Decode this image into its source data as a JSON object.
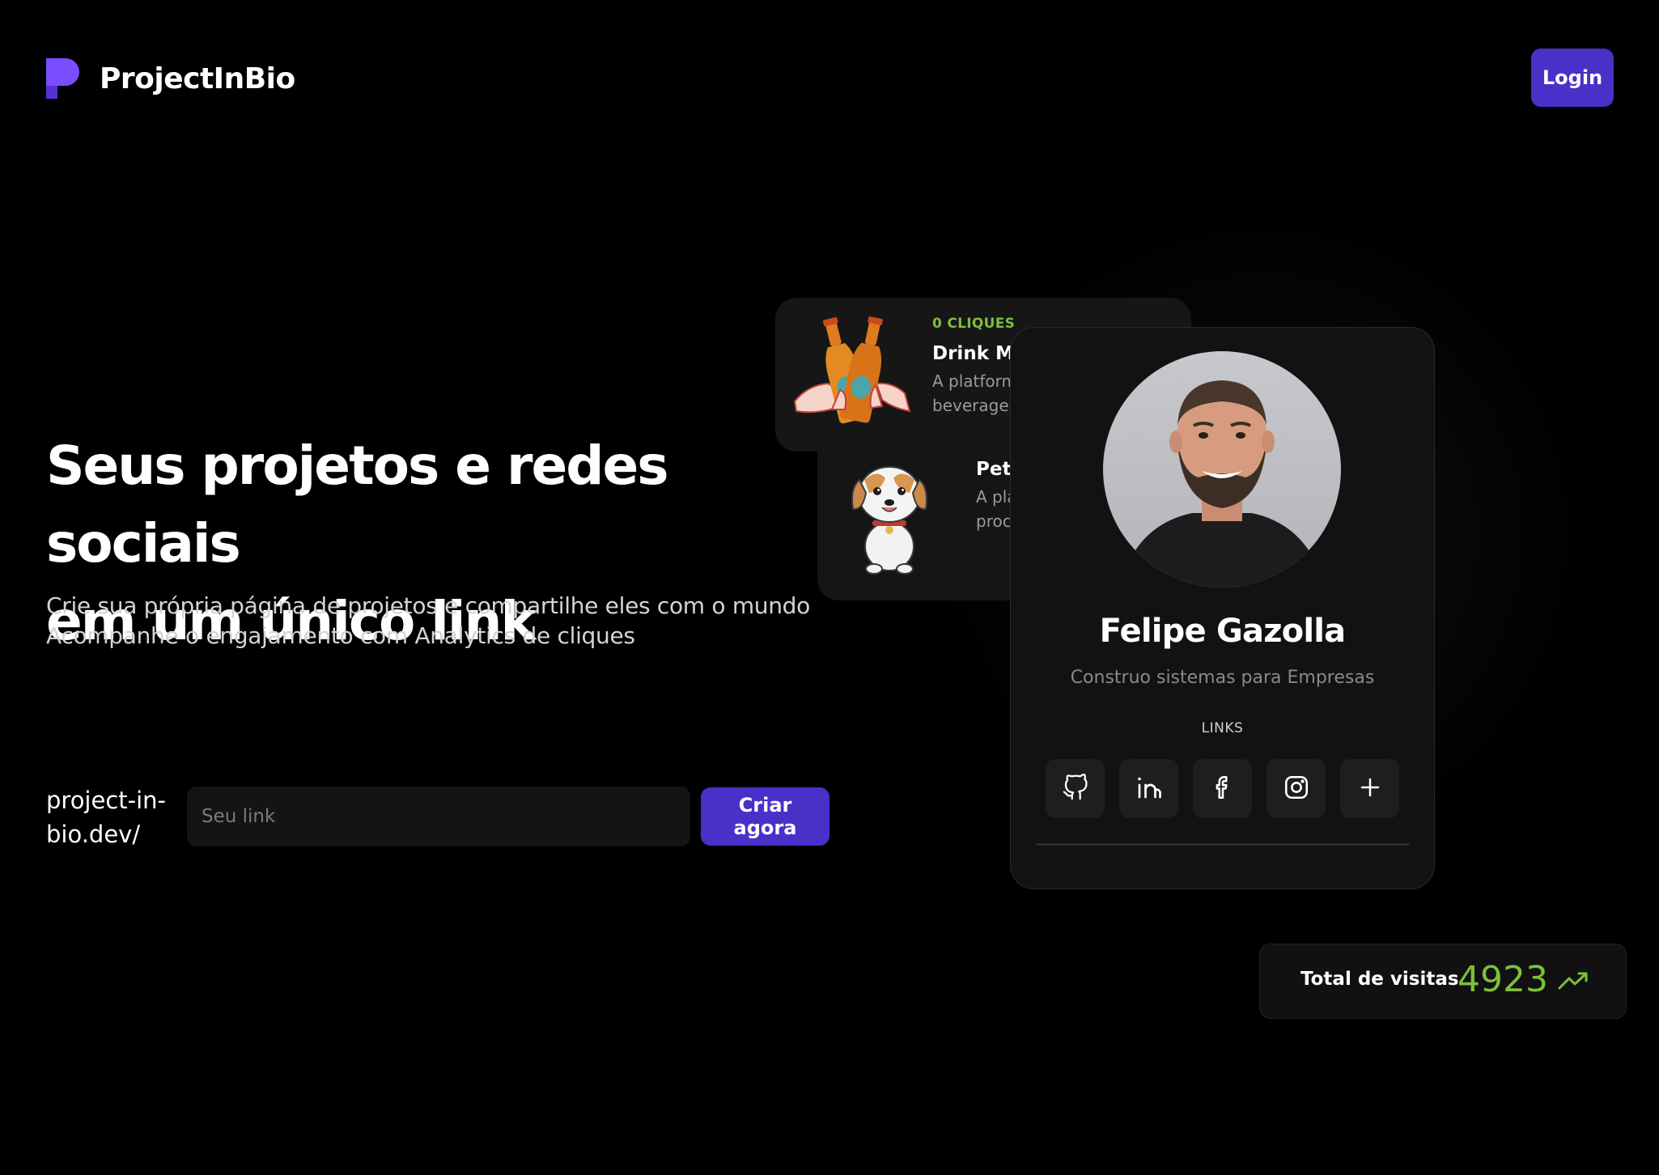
{
  "header": {
    "brand": "ProjectInBio",
    "login_label": "Login"
  },
  "hero": {
    "title_line1": "Seus projetos e redes sociais",
    "title_line2": "em um único link",
    "subtitle_line1": "Crie sua própria página de projetos e compartilhe eles com o mundo",
    "subtitle_line2": "Acompanhe o engajamento com Analytics de cliques"
  },
  "link_form": {
    "prefix_line1": "project-in-",
    "prefix_line2": "bio.dev/",
    "placeholder": "Seu link",
    "submit_label": "Criar agora"
  },
  "projects": [
    {
      "clicks": "0 CLIQUES",
      "name": "Drink Ma",
      "desc_line1": "A platform",
      "desc_line2": "beverages"
    },
    {
      "name": "Pets",
      "desc_line1": "A pla",
      "desc_line2": "proc"
    }
  ],
  "profile": {
    "name": "Felipe Gazolla",
    "bio": "Construo sistemas para Empresas",
    "links_label": "LINKS",
    "socials": [
      "github-icon",
      "linkedin-icon",
      "facebook-icon",
      "instagram-icon",
      "plus-icon"
    ]
  },
  "stats": {
    "visits_label": "Total de visitas",
    "visits_count": "4923"
  },
  "colors": {
    "accent": "#4b2fc9",
    "success": "#7dbf3a",
    "background": "#000000"
  }
}
